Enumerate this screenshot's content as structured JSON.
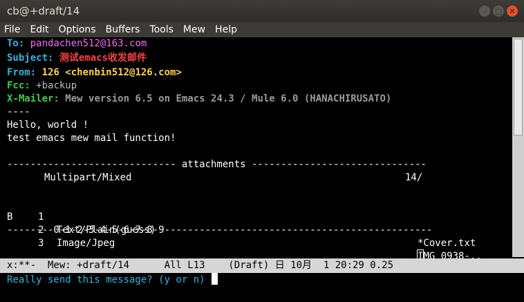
{
  "window": {
    "title": "cb@+draft/14"
  },
  "menu": [
    "File",
    "Edit",
    "Options",
    "Buffers",
    "Tools",
    "Mew",
    "Help"
  ],
  "headers": {
    "to": {
      "key": "To:",
      "value": "pandachen512@163.com"
    },
    "subject": {
      "key": "Subject:",
      "value": "测试emacs收发邮件"
    },
    "from": {
      "key": "From:",
      "value": "126 <chenbin512@126.com>"
    },
    "fcc": {
      "key": "Fcc:",
      "value": "+backup"
    },
    "xmailer": {
      "key": "X-Mailer:",
      "value": "Mew version 6.5 on Emacs 24.3 / Mule 6.0 (HANACHIRUSATO)"
    }
  },
  "separator": "----",
  "body_lines": [
    "Hello, world !",
    "test emacs mew mail function!"
  ],
  "attachments": {
    "banner": "----------------------------- attachments ------------------------------",
    "multipart": {
      "label": "Multipart/Mixed",
      "path": "14/"
    },
    "rows": [
      {
        "mark": " ",
        "num": "1",
        "type": "Text/Plain(guess)",
        "name": "*Cover.txt"
      },
      {
        "mark": "B",
        "num": "2",
        "type": "Image/Jpeg",
        "name_cursor": "I",
        "name_rest": "MG_0938-.."
      },
      {
        "mark": " ",
        "num": "3",
        "type": "",
        "name": "."
      }
    ],
    "footer": "--------0-1-2-3-4-5-6-7-8-9----------------------------------------------"
  },
  "modeline": "x:**-  Mew: +draft/14      All L13    (Draft) 日 10月  1 20:29 0.25",
  "minibuffer": "Really send this message? (y or n)"
}
